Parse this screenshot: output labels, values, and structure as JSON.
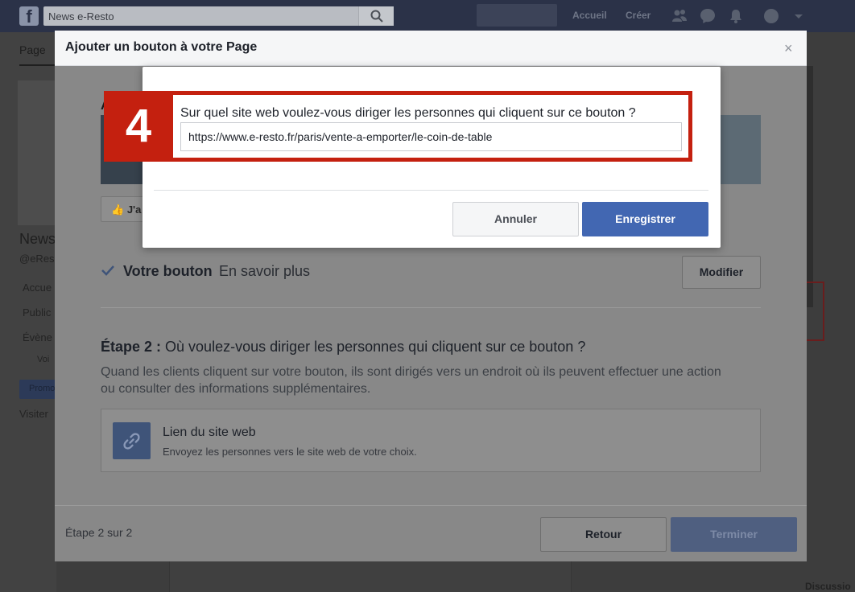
{
  "topbar": {
    "search_value": "News e-Resto",
    "nav_home": "Accueil",
    "nav_create": "Créer",
    "icons": [
      "friends-icon",
      "messenger-icon",
      "notifications-icon",
      "help-icon",
      "dropdown-icon"
    ]
  },
  "background_page": {
    "tab_label": "Page",
    "page_name": "News",
    "page_handle": "@eRes",
    "menu_items": [
      "Accue",
      "Public",
      "Évène",
      "Voi"
    ],
    "promo_label": "Promo",
    "visit_label": "Visiter",
    "like_label": "J'a",
    "cover_letter": "A",
    "discussion_label": "Discussio"
  },
  "modal": {
    "title": "Ajouter un bouton à votre Page",
    "close_label": "×",
    "votre_bouton_label": "Votre bouton",
    "votre_bouton_value": "En savoir plus",
    "modifier_label": "Modifier",
    "etape_title_strong": "Étape 2 :",
    "etape_title_rest": " Où voulez-vous diriger les personnes qui cliquent sur ce bouton ?",
    "etape_description": "Quand les clients cliquent sur votre bouton, ils sont dirigés vers un endroit où ils peuvent effectuer une action ou consulter des informations supplémentaires.",
    "link_option_title": "Lien du site web",
    "link_option_desc": "Envoyez les personnes vers le site web de votre choix.",
    "step_counter": "Étape 2 sur 2",
    "retour_label": "Retour",
    "terminer_label": "Terminer"
  },
  "inner_dialog": {
    "step_number": "4",
    "question": "Sur quel site web voulez-vous diriger les personnes qui cliquent sur ce bouton ?",
    "url_value": "https://www.e-resto.fr/paris/vente-a-emporter/le-coin-de-table",
    "annuler_label": "Annuler",
    "enregistrer_label": "Enregistrer"
  },
  "colors": {
    "accent_blue": "#4267b2",
    "highlight_red": "#c4200f",
    "topbar": "#2b3248"
  }
}
